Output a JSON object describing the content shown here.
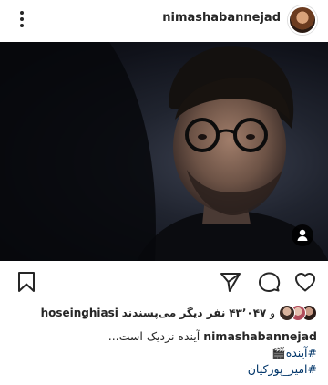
{
  "header": {
    "username": "nimashabannejad"
  },
  "likes": {
    "first_liker": "hoseinghiasi",
    "prefix": "و",
    "count": "۴۳٬۰۴۷",
    "suffix": "نفر دیگر می‌پسندند"
  },
  "caption": {
    "username": "nimashabannejad",
    "text": "آینده نزدیک است...",
    "hashtags": [
      "#آینده🎬",
      "#امیر_پورکیان"
    ]
  },
  "icons": [
    "more-icon",
    "user-tag-icon",
    "bookmark-icon",
    "share-icon",
    "comment-icon",
    "like-icon"
  ],
  "colors": {
    "text": "#262626",
    "hashtag": "#003569"
  }
}
